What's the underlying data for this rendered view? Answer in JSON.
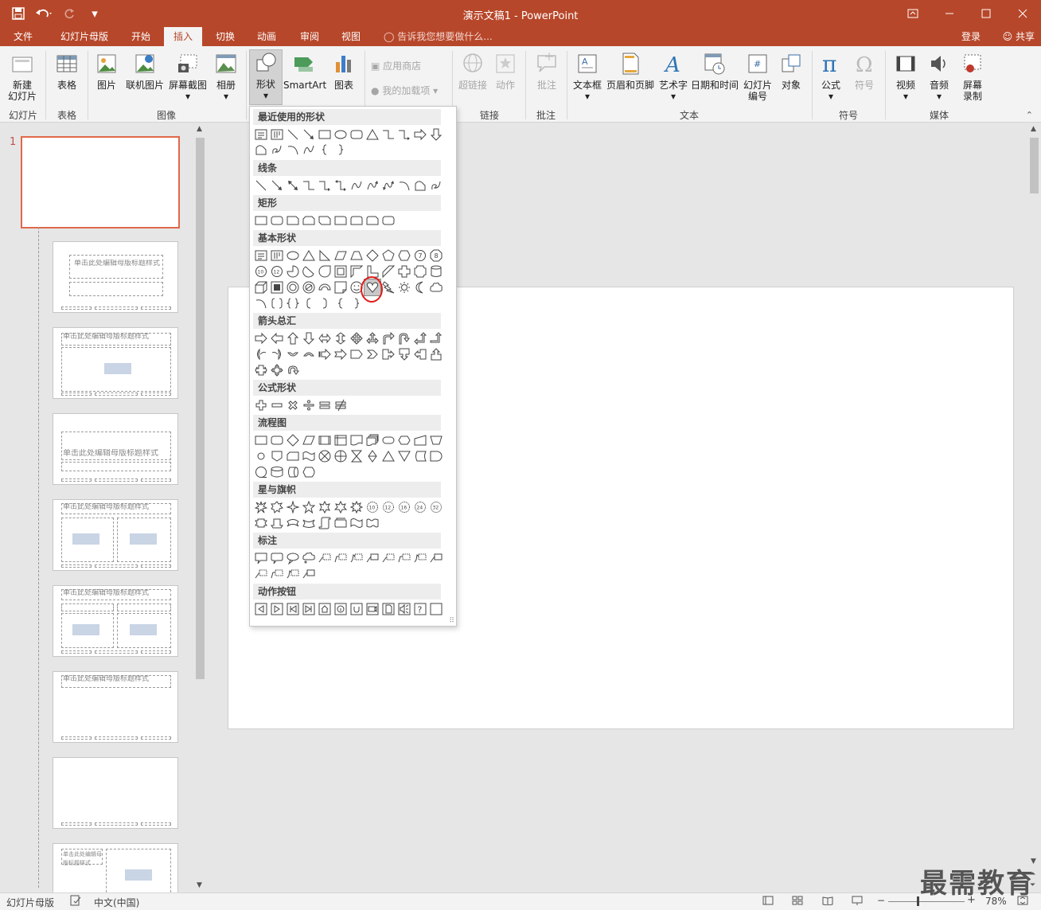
{
  "window": {
    "title": "演示文稿1 - PowerPoint"
  },
  "qat": {
    "save_icon": "save-icon",
    "undo_icon": "undo-icon",
    "redo_icon": "redo-icon",
    "customize": "▾"
  },
  "tabs": [
    {
      "label": "文件"
    },
    {
      "label": "幻灯片母版"
    },
    {
      "label": "开始"
    },
    {
      "label": "插入",
      "active": true
    },
    {
      "label": "切换"
    },
    {
      "label": "动画"
    },
    {
      "label": "审阅"
    },
    {
      "label": "视图"
    }
  ],
  "tell_me": "告诉我您想要做什么...",
  "account": {
    "login": "登录",
    "share": "共享"
  },
  "ribbon": {
    "new_slide": "新建\n幻灯片",
    "table": "表格",
    "picture": "图片",
    "online_picture": "联机图片",
    "screenshot": "屏幕截图",
    "album": "相册",
    "shapes": "形状",
    "smartart": "SmartArt",
    "chart": "图表",
    "store": "应用商店",
    "my_addins": "我的加载项",
    "hyperlink": "超链接",
    "action": "动作",
    "comment": "批注",
    "textbox": "文本框",
    "header_footer": "页眉和页脚",
    "wordart": "艺术字",
    "datetime": "日期和时间",
    "slide_number": "幻灯片\n编号",
    "object": "对象",
    "equation": "公式",
    "symbol": "符号",
    "video": "视频",
    "audio": "音频",
    "screen_record": "屏幕\n录制",
    "groups": {
      "slides": "幻灯片",
      "tables": "表格",
      "images": "图像",
      "links": "链接",
      "comments": "批注",
      "text": "文本",
      "symbols": "符号",
      "media": "媒体"
    }
  },
  "shapes_menu": {
    "sections": [
      "最近使用的形状",
      "线条",
      "矩形",
      "基本形状",
      "箭头总汇",
      "公式形状",
      "流程图",
      "星与旗帜",
      "标注",
      "动作按钮"
    ]
  },
  "thumbs": {
    "slide_number": "1",
    "t1": "单击此处编辑母版标题样式",
    "t2": "单击此处编辑母版标题样式",
    "t3": "单击此处编辑母版标题样式",
    "t4": "单击此处编辑母版标题样式",
    "t5": "单击此处编辑母版标题样式",
    "t6": "单击此处编辑母版标题样式",
    "t8": "单击此处编辑母版标题样式"
  },
  "status": {
    "view": "幻灯片母版",
    "language": "中文(中国)",
    "zoom": "78%",
    "zoom_level": 0.78
  },
  "watermark": "最需教育"
}
